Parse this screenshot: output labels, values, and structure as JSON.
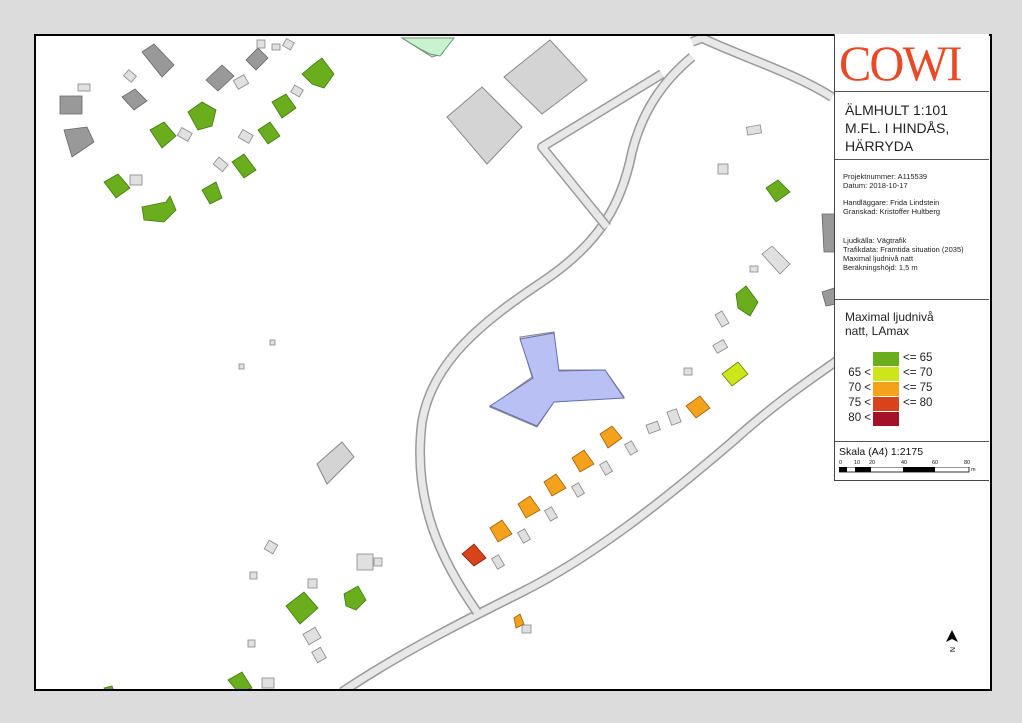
{
  "logo": "COWI",
  "title": {
    "line1": "ÄLMHULT 1:101",
    "line2": "M.FL. I HINDÅS,",
    "line3": "HÄRRYDA"
  },
  "info": {
    "projektnummer": "Projektnummer: A115539",
    "datum": "Datum: 2018-10-17",
    "handlaggare": "Handläggare: Frida Lindstein",
    "granskad": "Granskad: Kristoffer Hultberg",
    "ljudkalla": "Ljudkälla: Vägtrafik",
    "trafikdata": "Trafikdata: Framtida situation (2035)",
    "maximal": "Maximal ljudnivå natt",
    "berakningshojd": "Beräkningshöjd: 1,5 m"
  },
  "legend": {
    "title1": "Maximal ljudnivå",
    "title2": "natt, LAmax",
    "classes": [
      {
        "lower": "",
        "upper": "<= 65",
        "color": "#6aae1e"
      },
      {
        "lower": "65 <",
        "upper": "<= 70",
        "color": "#cde61a"
      },
      {
        "lower": "70 <",
        "upper": "<= 75",
        "color": "#f4a21c"
      },
      {
        "lower": "75 <",
        "upper": "<= 80",
        "color": "#d8431a"
      },
      {
        "lower": "80 <",
        "upper": "",
        "color": "#a51228"
      }
    ]
  },
  "scale": {
    "title": "Skala (A4) 1:2175",
    "ticks": [
      "0",
      "10",
      "20",
      "40",
      "60",
      "80"
    ],
    "unit": "m"
  },
  "north": "N",
  "colors": {
    "road_fill": "#e8e8e8",
    "road_edge": "#9a9a9a",
    "building_grey": "#a6a6a6",
    "school": "#b8c0f4",
    "mint": "#c8f2d0"
  }
}
